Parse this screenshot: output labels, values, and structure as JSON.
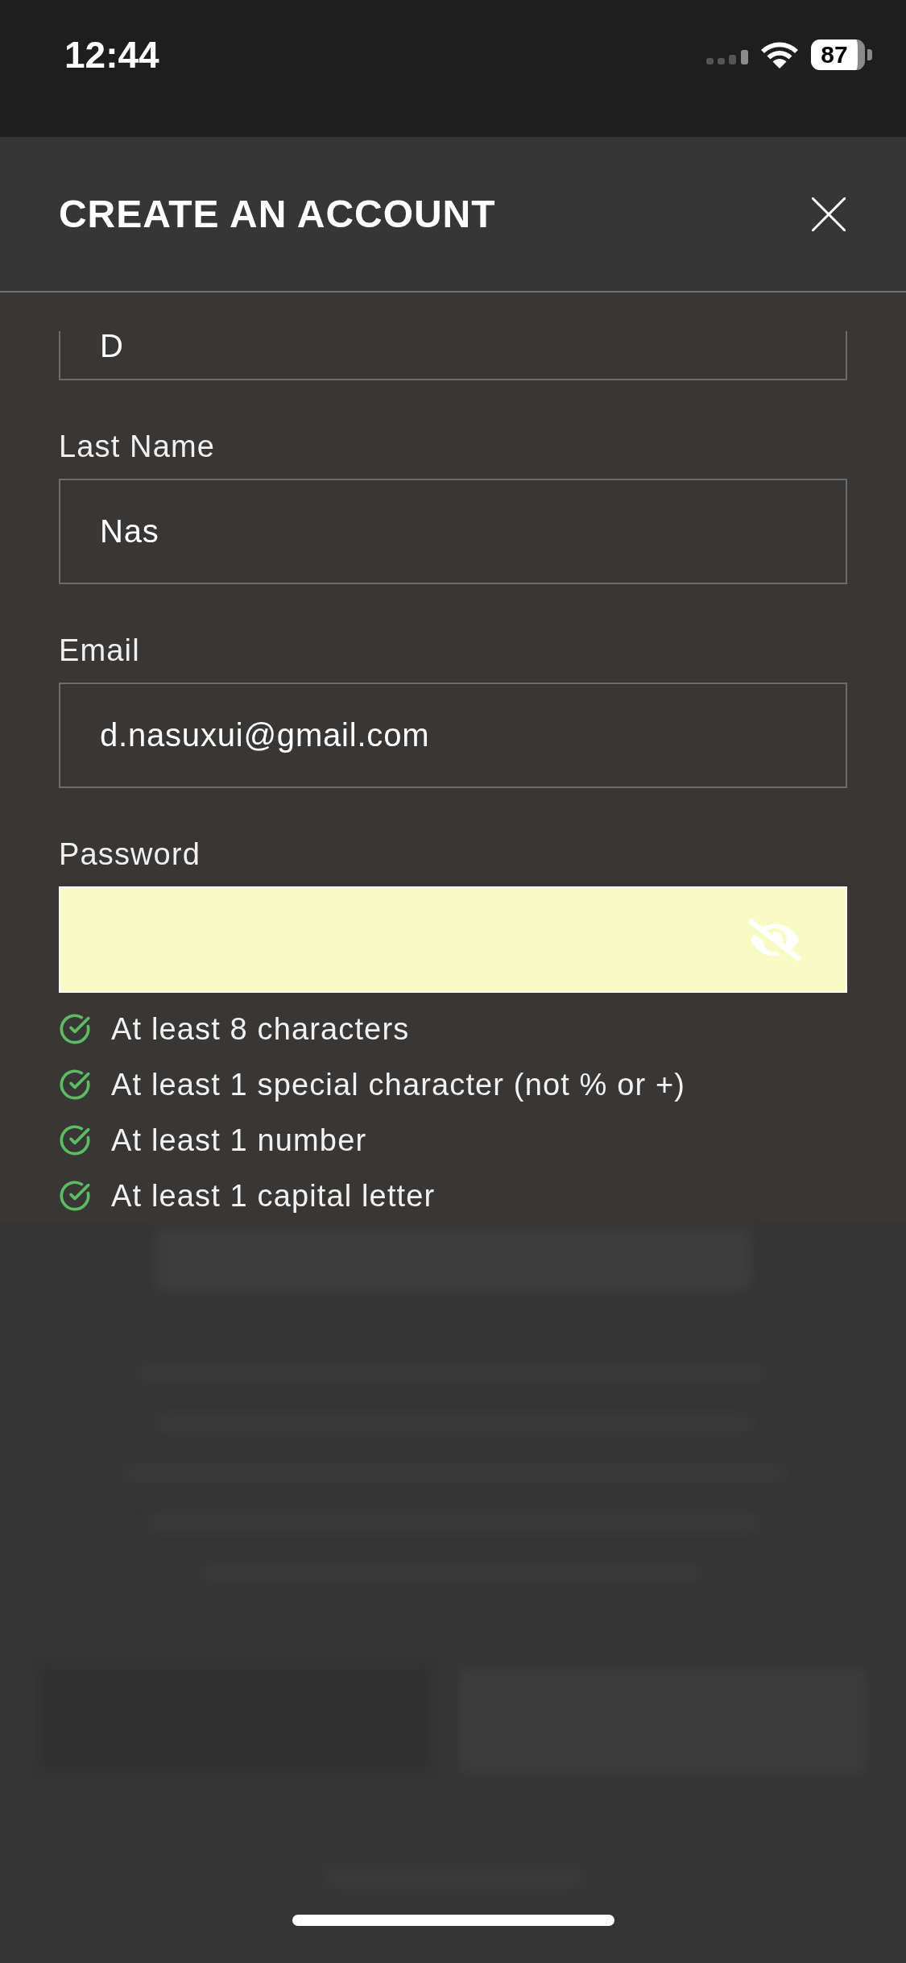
{
  "status_bar": {
    "time": "12:44",
    "battery": "87"
  },
  "modal": {
    "title": "CREATE AN ACCOUNT"
  },
  "fields": [
    {
      "kind": "partial",
      "value": "D",
      "highlighted": false
    },
    {
      "kind": "text",
      "label": "Last Name",
      "value": "Nas",
      "highlighted": false
    },
    {
      "kind": "text",
      "label": "Email",
      "value": "d.nasuxui@gmail.com",
      "highlighted": false
    },
    {
      "kind": "password",
      "label": "Password",
      "highlighted": true
    }
  ],
  "requirements": [
    {
      "text": "At least 8 characters",
      "met": true
    },
    {
      "text": "At least 1 special character (not % or +)",
      "met": true
    },
    {
      "text": "At least 1 number",
      "met": true
    },
    {
      "text": "At least 1 capital letter",
      "met": true
    }
  ]
}
